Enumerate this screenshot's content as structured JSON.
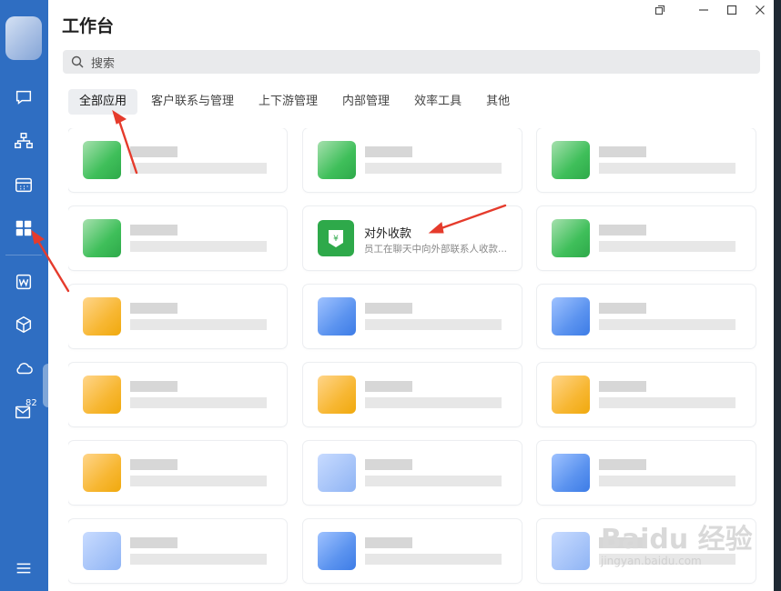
{
  "window": {
    "title": "工作台"
  },
  "search": {
    "placeholder": "搜索"
  },
  "tabs": [
    "全部应用",
    "客户联系与管理",
    "上下游管理",
    "内部管理",
    "效率工具",
    "其他"
  ],
  "sidebar": {
    "mail_badge": "82"
  },
  "highlight_card": {
    "name": "对外收款",
    "desc": "员工在聊天中向外部联系人收款..."
  },
  "watermark": {
    "text": "Baidu 经验",
    "url": "jingyan.baidu.com"
  },
  "colors": {
    "rail": "#2f6ec2",
    "accent": "#2ea94a",
    "arrow": "#e53b2c"
  }
}
